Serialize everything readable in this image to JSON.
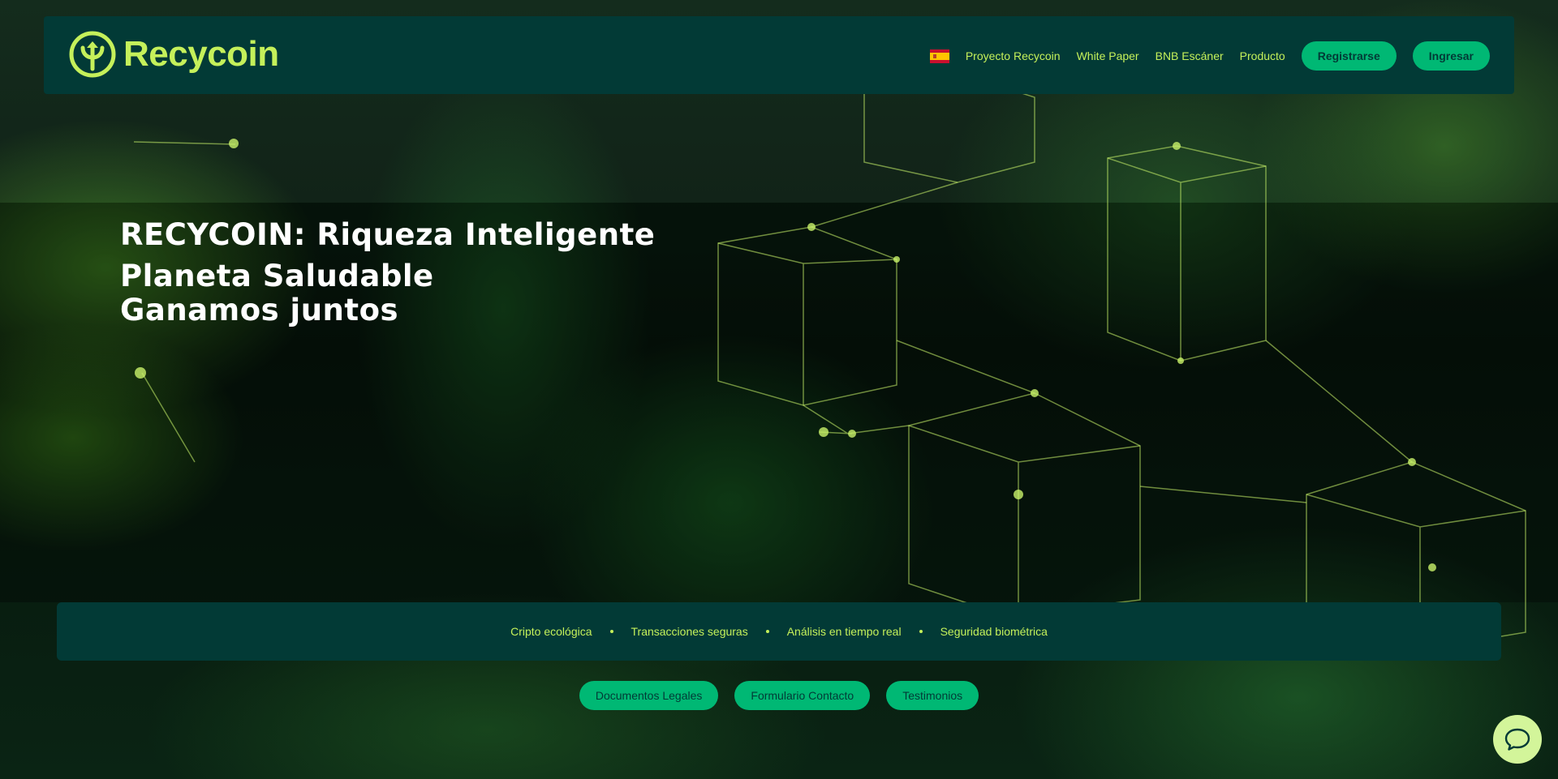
{
  "brand": {
    "name": "Recycoin",
    "accent": "#c5f05a",
    "primary": "#023a36",
    "button": "#00b874"
  },
  "nav": {
    "language_flag": "spain-flag-icon",
    "links": [
      "Proyecto Recycoin",
      "White Paper",
      "BNB Escáner",
      "Producto"
    ],
    "register_label": "Registrarse",
    "login_label": "Ingresar"
  },
  "hero": {
    "line1": "RECYCOIN: Riqueza Inteligente",
    "line2": "Planeta Saludable",
    "line3": "Ganamos juntos"
  },
  "features": [
    "Cripto ecológica",
    "Transacciones seguras",
    "Análisis en tiempo real",
    "Seguridad biométrica"
  ],
  "footer_links": [
    "Documentos Legales",
    "Formulario Contacto",
    "Testimonios"
  ],
  "chat": {
    "icon": "chat-bubble-icon"
  }
}
